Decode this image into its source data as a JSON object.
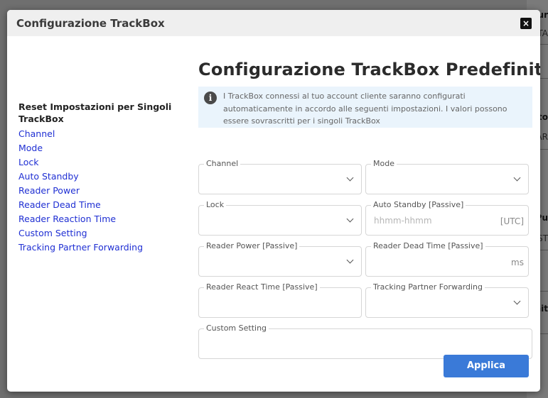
{
  "background": {
    "text_fragments": [
      "ur",
      "TA",
      "ato",
      "AR",
      "Pu",
      "ST",
      "nit"
    ]
  },
  "modal": {
    "title": "Configurazione TrackBox",
    "close_label": "×"
  },
  "sidebar": {
    "heading": "Reset Impostazioni per Singoli TrackBox",
    "links": [
      "Channel",
      "Mode",
      "Lock",
      "Auto Standby",
      "Reader Power",
      "Reader Dead Time",
      "Reader Reaction Time",
      "Custom Setting",
      "Tracking Partner Forwarding"
    ]
  },
  "main": {
    "title": "Configurazione TrackBox Predefinita",
    "info_icon": "info-icon",
    "info_text": "I TrackBox connessi al tuo account cliente saranno configurati automaticamente in accordo alle seguenti impostazioni. I valori possono essere sovrascritti per i singoli TrackBox"
  },
  "fields": {
    "channel": {
      "label": "Channel",
      "value": ""
    },
    "mode": {
      "label": "Mode",
      "value": ""
    },
    "lock": {
      "label": "Lock",
      "value": ""
    },
    "auto_standby": {
      "label": "Auto Standby [Passive]",
      "placeholder": "hhmm-hhmm",
      "suffix": "[UTC]"
    },
    "reader_power": {
      "label": "Reader Power [Passive]",
      "value": ""
    },
    "reader_dead_time": {
      "label": "Reader Dead Time [Passive]",
      "suffix": "ms"
    },
    "reader_react_time": {
      "label": "Reader React Time [Passive]",
      "value": ""
    },
    "tracking_partner_forwarding": {
      "label": "Tracking Partner Forwarding",
      "value": ""
    },
    "custom_setting": {
      "label": "Custom Setting",
      "value": ""
    }
  },
  "actions": {
    "apply_label": "Applica"
  },
  "colors": {
    "link": "#1f2fd3",
    "primary_button": "#3a7ad8",
    "info_background": "#eaf4fc",
    "header_background": "#efefef"
  }
}
